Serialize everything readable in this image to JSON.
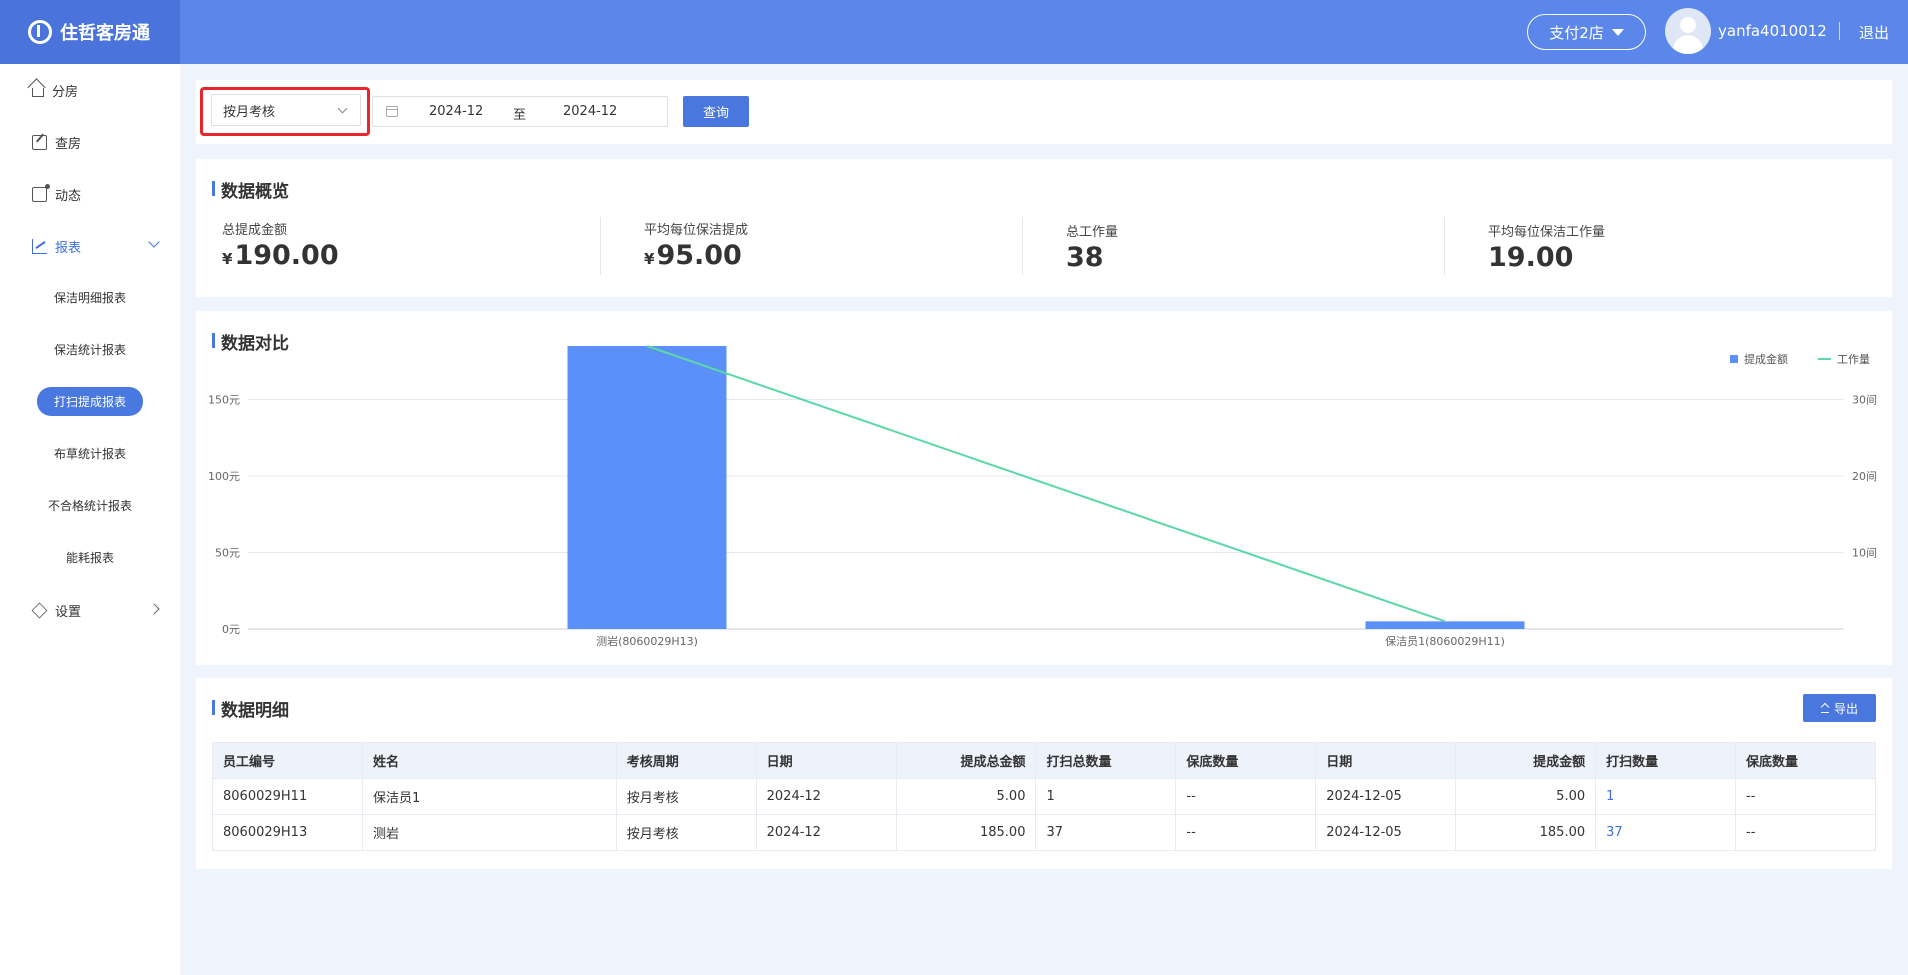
{
  "app": {
    "brand": "住哲客房通"
  },
  "header": {
    "store": "支付2店",
    "username": "yanfa4010012",
    "logout": "退出"
  },
  "sidebar": {
    "items": [
      {
        "label": "分房",
        "icon": "home-icon"
      },
      {
        "label": "查房",
        "icon": "edit-icon"
      },
      {
        "label": "动态",
        "icon": "activity-icon"
      },
      {
        "label": "报表",
        "icon": "chart-icon"
      },
      {
        "label": "设置",
        "icon": "layers-icon"
      }
    ],
    "sub_items": [
      "保洁明细报表",
      "保洁统计报表",
      "打扫提成报表",
      "布草统计报表",
      "不合格统计报表",
      "能耗报表"
    ]
  },
  "filter": {
    "period_type": "按月考核",
    "date_from": "2024-12",
    "date_sep": "至",
    "date_to": "2024-12",
    "query_label": "查询"
  },
  "overview": {
    "title": "数据概览",
    "currency": "¥",
    "stats": [
      {
        "label": "总提成金额",
        "value": "190.00",
        "currency": true
      },
      {
        "label": "平均每位保洁提成",
        "value": "95.00",
        "currency": true
      },
      {
        "label": "总工作量",
        "value": "38",
        "currency": false
      },
      {
        "label": "平均每位保洁工作量",
        "value": "19.00",
        "currency": false
      }
    ]
  },
  "compare": {
    "title": "数据对比"
  },
  "chart_data": {
    "type": "bar",
    "categories": [
      "测岩(8060029H13)",
      "保洁员1(8060029H11)"
    ],
    "series": [
      {
        "name": "提成金额",
        "type": "bar",
        "axis": "left",
        "values": [
          185,
          5
        ],
        "color": "#5b8ff9"
      },
      {
        "name": "工作量",
        "type": "line",
        "axis": "right",
        "values": [
          37,
          1
        ],
        "color": "#5ad8a6"
      }
    ],
    "y_left": {
      "ticks": [
        "0元",
        "50元",
        "100元",
        "150元"
      ],
      "tick_values": [
        0,
        50,
        100,
        150
      ],
      "max": 185
    },
    "y_right": {
      "ticks": [
        "10间",
        "20间",
        "30间"
      ],
      "tick_values": [
        10,
        20,
        30
      ],
      "max": 37
    },
    "legend": "top-right",
    "grid": true
  },
  "detail": {
    "title": "数据明细",
    "export_label": "导出",
    "columns": [
      "员工编号",
      "姓名",
      "考核周期",
      "日期",
      "提成总金额",
      "打扫总数量",
      "保底数量",
      "日期",
      "提成金额",
      "打扫数量",
      "保底数量"
    ],
    "rows": [
      [
        "8060029H11",
        "保洁员1",
        "按月考核",
        "2024-12",
        "5.00",
        "1",
        "--",
        "2024-12-05",
        "5.00",
        "1",
        "--"
      ],
      [
        "8060029H13",
        "测岩",
        "按月考核",
        "2024-12",
        "185.00",
        "37",
        "--",
        "2024-12-05",
        "185.00",
        "37",
        "--"
      ]
    ]
  }
}
